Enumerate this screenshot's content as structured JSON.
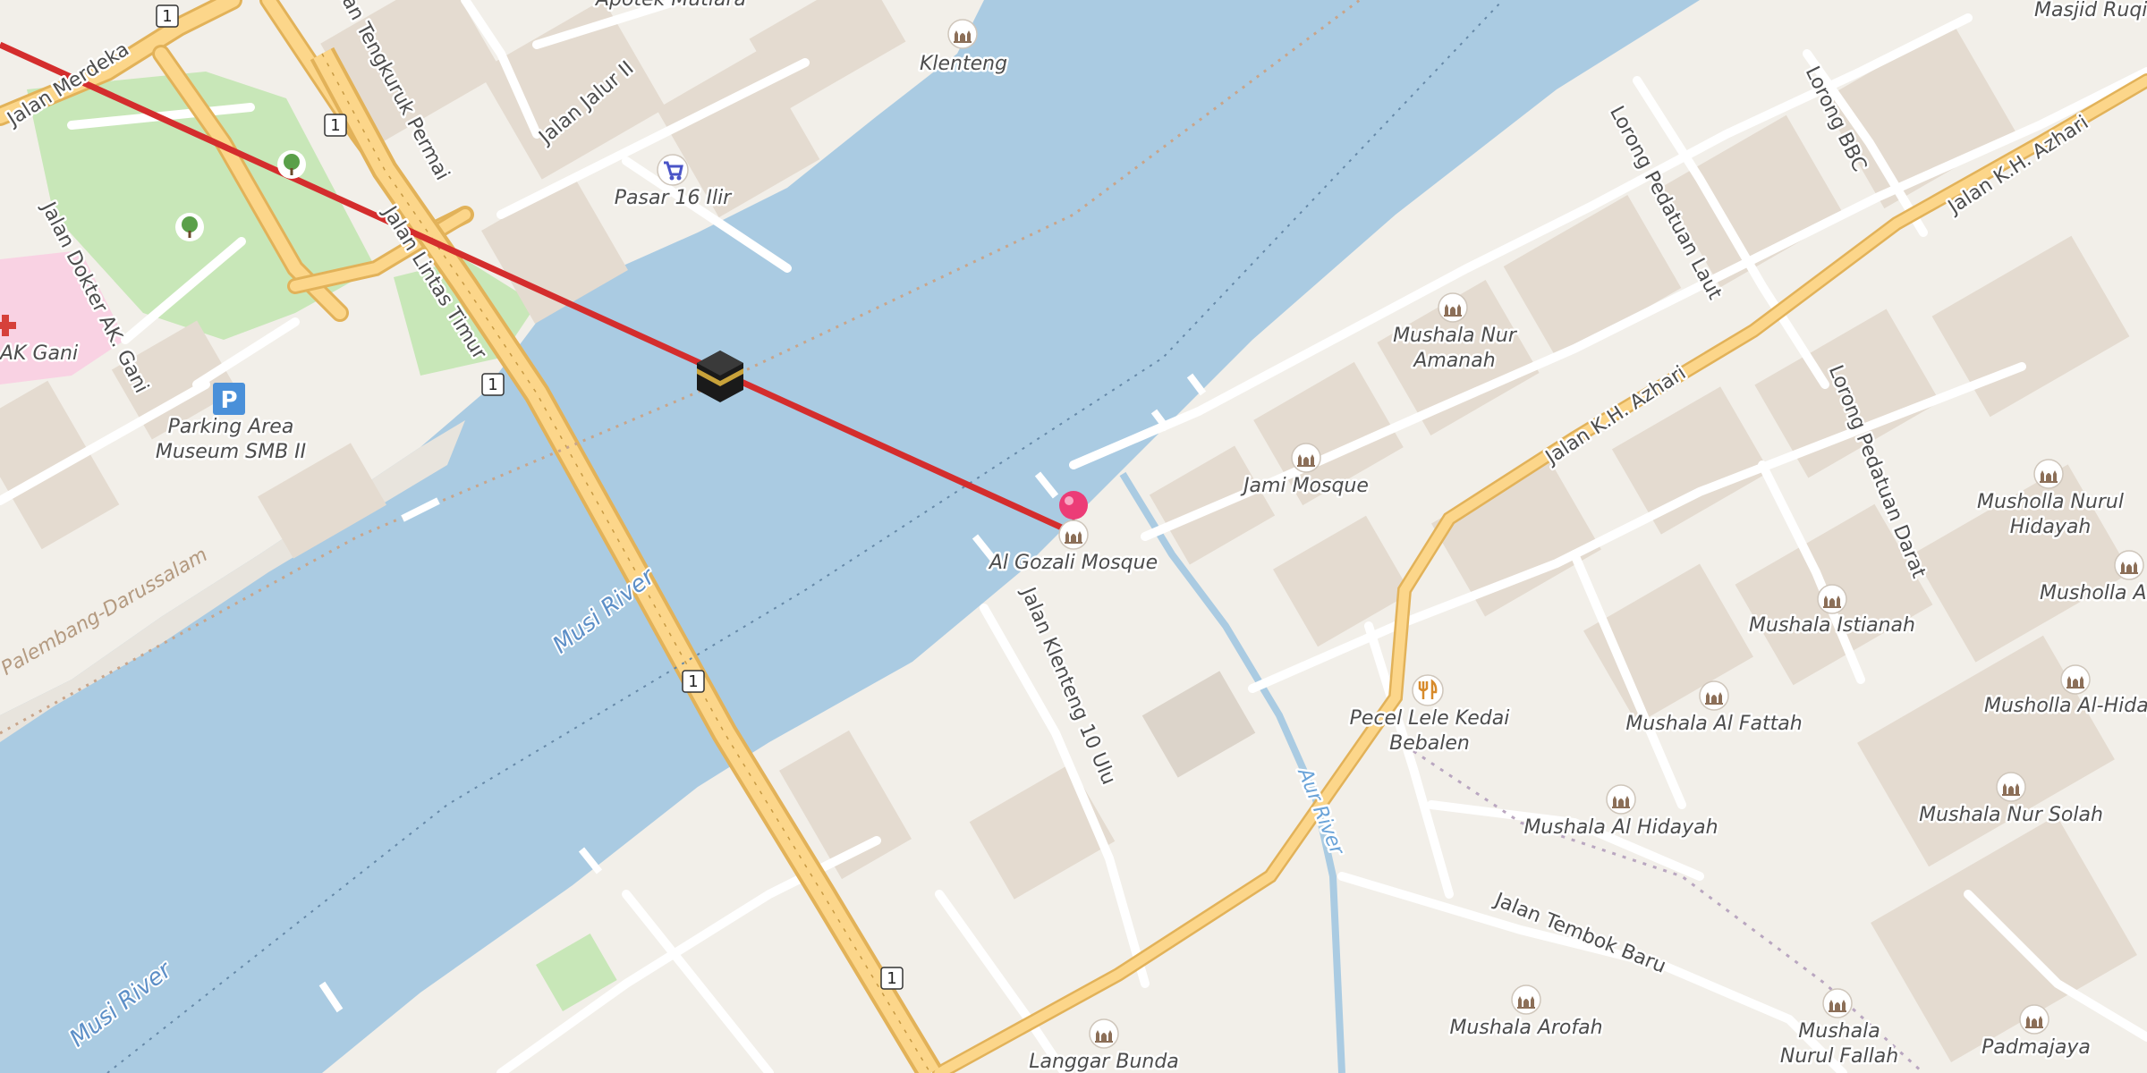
{
  "map": {
    "colors": {
      "land": "#f2efe9",
      "water": "#aacbe2",
      "primary_road": "#fcd68a",
      "primary_casing": "#e2b259",
      "minor_road": "#ffffff",
      "building": "#e4dbd0",
      "park": "#c8e7b8",
      "hospital": "#f9d2e3",
      "qibla_line": "#d42d2d",
      "pin": "#ec3c77",
      "poi_icon": "#8c6f58"
    },
    "route_shields": [
      "1",
      "1",
      "1",
      "1",
      "1"
    ],
    "poi_labels": {
      "klenteng": "Klenteng",
      "pasar": "Pasar 16 Ilir",
      "apotek": "Apotek Mutiara",
      "hospital": "AK Gani",
      "parking": "Parking Area\nMuseum SMB II",
      "al_gozali": "Al Gozali Mosque",
      "jami": "Jami Mosque",
      "nur_amanah": "Mushala Nur\nAmanah",
      "pecel": "Pecel Lele Kedai\nBebalen",
      "istianah": "Mushala Istianah",
      "al_fattah": "Mushala Al Fattah",
      "al_hidayah": "Mushala Al Hidayah",
      "nurul_hidayah": "Musholla Nurul\nHidayah",
      "musholla_al": "Musholla Al",
      "al_hiday": "Musholla Al-Hiday",
      "nur_solah": "Mushala Nur Solah",
      "arofah": "Mushala Arofah",
      "nurul_fallah": "Mushala\nNurul Fallah",
      "padmajaya": "Padmajaya",
      "langgar": "Langgar Bunda",
      "masjid_ruqi": "Masjid Ruqi"
    },
    "road_labels": {
      "merdeka": "Jalan Merdeka",
      "tengkuruk": "Jalan Tengkuruk Permai",
      "jalur": "Jalan Jalur II",
      "lintas_timur": "Jalan Lintas Timur",
      "dokter": "Jalan Dokter AK. Gani",
      "azhari_1": "Jalan K.H. Azhari",
      "azhari_2": "Jalan K.H. Azhari",
      "lorong_bbc": "Lorong BBC",
      "pedatuan_laut": "Lorong Pedatuan Laut",
      "pedatuan_darat": "Lorong Pedatuan Darat",
      "klenteng_10": "Jalan Klenteng 10 Ulu",
      "tembok_baru": "Jalan Tembok Baru"
    },
    "water_labels": {
      "musi_1": "Musi River",
      "musi_2": "Musi River",
      "aur": "Aur River"
    },
    "area_labels": {
      "darussalam": "Palembang-Darussalam"
    },
    "icons": {
      "kaaba": "kaaba-icon",
      "pin": "location-pin-icon",
      "mosque": "mosque-icon",
      "parking": "parking-icon",
      "tree": "tree-icon",
      "cart": "shopping-cart-icon",
      "hospital": "hospital-cross-icon",
      "restaurant": "restaurant-icon"
    }
  }
}
